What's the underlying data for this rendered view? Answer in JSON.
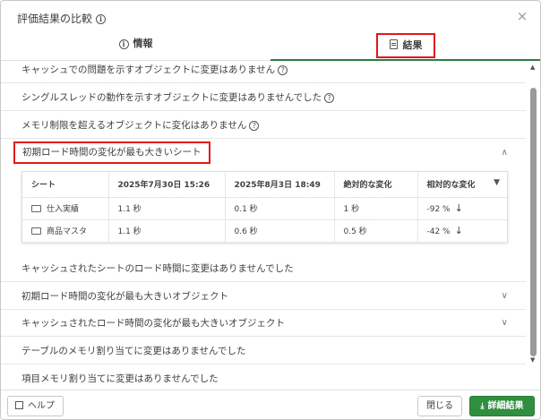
{
  "dialog": {
    "title": "評価結果の比較",
    "close_icon": "×"
  },
  "tabs": [
    {
      "label": "情報",
      "icon": "info-icon"
    },
    {
      "label": "結果",
      "icon": "document-icon"
    }
  ],
  "results": {
    "items_before": [
      {
        "text": "キャッシュでの問題を示すオブジェクトに変更はありません",
        "has_help": true
      },
      {
        "text": "シングルスレッドの動作を示すオブジェクトに変更はありませんでした",
        "has_help": true
      },
      {
        "text": "メモリ制限を超えるオブジェクトに変化はありません",
        "has_help": true
      }
    ],
    "expanded_section": {
      "title": "初期ロード時間の変化が最も大きいシート",
      "columns": [
        "シート",
        "2025年7月30日 15:26",
        "2025年8月3日 18:49",
        "絶対的な変化",
        "相対的な変化"
      ],
      "rows": [
        {
          "name": "仕入実績",
          "before": "1.1 秒",
          "after": "0.1 秒",
          "absolute": "1 秒",
          "relative": "-92 %"
        },
        {
          "name": "商品マスタ",
          "before": "1.1 秒",
          "after": "0.6 秒",
          "absolute": "0.5 秒",
          "relative": "-42 %"
        }
      ]
    },
    "items_after": [
      {
        "text": "キャッシュされたシートのロード時間に変更はありませんでした",
        "collapsible": false
      },
      {
        "text": "初期ロード時間の変化が最も大きいオブジェクト",
        "collapsible": true
      },
      {
        "text": "キャッシュされたロード時間の変化が最も大きいオブジェクト",
        "collapsible": true
      },
      {
        "text": "テーブルのメモリ割り当てに変更はありませんでした",
        "collapsible": false
      },
      {
        "text": "項目メモリ割り当てに変更はありませんでした",
        "collapsible": false
      }
    ]
  },
  "footer": {
    "help_label": "ヘルプ",
    "close_label": "閉じる",
    "detail_label": "詳細結果"
  },
  "colors": {
    "accent_green": "#2f8f3e",
    "highlight_red": "#e0181c"
  }
}
